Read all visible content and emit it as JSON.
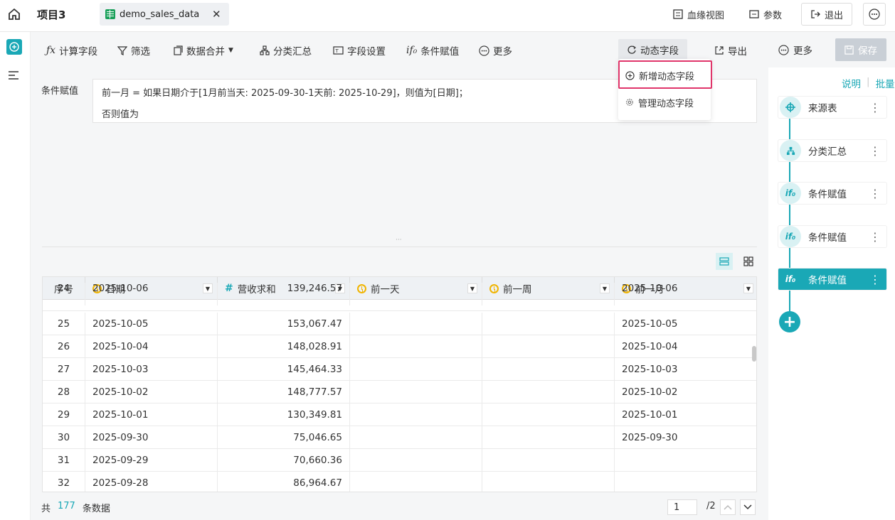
{
  "header": {
    "project": "项目3",
    "tab_title": "demo_sales_data",
    "tab_close": "✕",
    "lineage": "血缘视图",
    "params": "参数",
    "exit": "退出",
    "more_icon": "…"
  },
  "toolbar": {
    "calc": "计算字段",
    "filter": "筛选",
    "merge": "数据合并",
    "group": "分类汇总",
    "fieldset": "字段设置",
    "cond": "条件赋值",
    "more": "更多",
    "dynamic": "动态字段",
    "export": "导出",
    "more2": "更多",
    "save": "保存"
  },
  "dropdown": {
    "add": "新增动态字段",
    "manage": "管理动态字段"
  },
  "condition": {
    "label": "条件赋值",
    "line1": "前一月 = 如果日期介于[1月前当天: 2025-09-30-1天前: 2025-10-29]，则值为[日期]；",
    "line2": "否则值为"
  },
  "table": {
    "headers": [
      "序号",
      "日期",
      "营收求和",
      "前一天",
      "前一周",
      "前一月"
    ],
    "rows": [
      {
        "idx": "24",
        "date": "2025-10-06",
        "rev": "139,246.57",
        "d1": "",
        "w1": "",
        "m1": "2025-10-06"
      },
      {
        "idx": "25",
        "date": "2025-10-05",
        "rev": "153,067.47",
        "d1": "",
        "w1": "",
        "m1": "2025-10-05"
      },
      {
        "idx": "26",
        "date": "2025-10-04",
        "rev": "148,028.91",
        "d1": "",
        "w1": "",
        "m1": "2025-10-04"
      },
      {
        "idx": "27",
        "date": "2025-10-03",
        "rev": "145,464.33",
        "d1": "",
        "w1": "",
        "m1": "2025-10-03"
      },
      {
        "idx": "28",
        "date": "2025-10-02",
        "rev": "148,777.57",
        "d1": "",
        "w1": "",
        "m1": "2025-10-02"
      },
      {
        "idx": "29",
        "date": "2025-10-01",
        "rev": "130,349.81",
        "d1": "",
        "w1": "",
        "m1": "2025-10-01"
      },
      {
        "idx": "30",
        "date": "2025-09-30",
        "rev": "75,046.65",
        "d1": "",
        "w1": "",
        "m1": "2025-09-30"
      },
      {
        "idx": "31",
        "date": "2025-09-29",
        "rev": "70,660.36",
        "d1": "",
        "w1": "",
        "m1": ""
      },
      {
        "idx": "32",
        "date": "2025-09-28",
        "rev": "86,964.67",
        "d1": "",
        "w1": "",
        "m1": ""
      }
    ]
  },
  "footer": {
    "prefix": "共",
    "count": "177",
    "suffix": "条数据",
    "page": "1",
    "total": "/2"
  },
  "steps": {
    "explain": "说明",
    "batch": "批量",
    "items": [
      {
        "label": "来源表",
        "icon": "source-icon"
      },
      {
        "label": "分类汇总",
        "icon": "group-icon"
      },
      {
        "label": "条件赋值",
        "icon": "if-icon"
      },
      {
        "label": "条件赋值",
        "icon": "if-icon"
      },
      {
        "label": "条件赋值",
        "icon": "if-icon"
      }
    ]
  },
  "colors": {
    "accent": "#1aa8b6",
    "highlight": "#e0356a",
    "save_disabled": "#c9cfd6"
  }
}
